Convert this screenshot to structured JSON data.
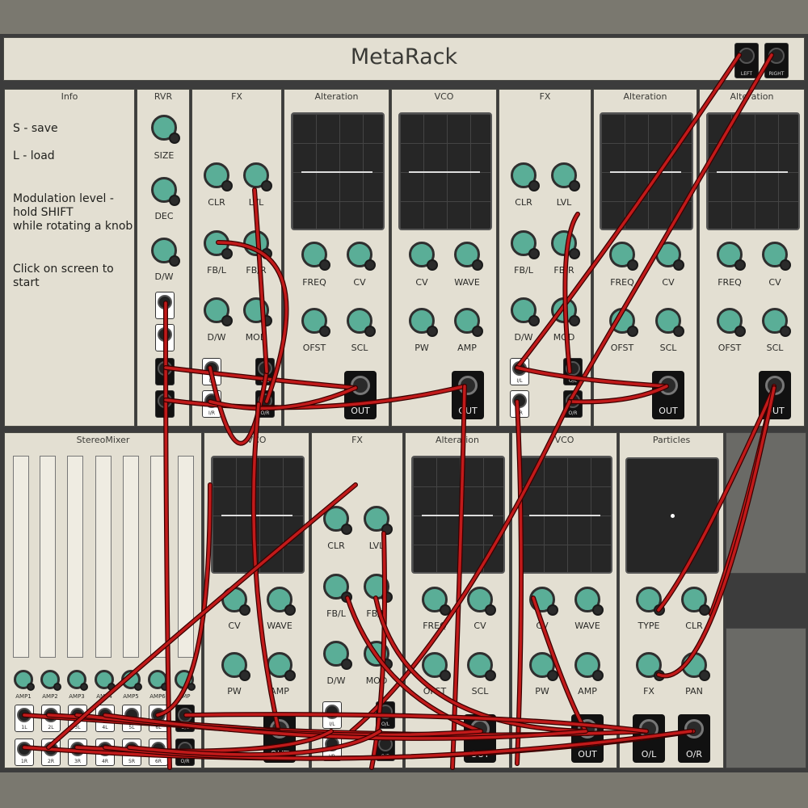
{
  "header": {
    "title": "MetaRack",
    "left_label": "LEFT",
    "right_label": "RIGHT"
  },
  "info": {
    "title": "Info",
    "line1": "S - save",
    "line2": "L - load",
    "line3": "Modulation level -",
    "line4": "hold SHIFT",
    "line5": "while rotating a knob",
    "line6": "Click on screen to start"
  },
  "rvr": {
    "title": "RVR",
    "size": "SIZE",
    "dec": "DEC",
    "dw": "D/W"
  },
  "fx": {
    "title": "FX",
    "clr": "CLR",
    "lvl": "LVL",
    "fbl": "FB/L",
    "fbr": "FB/R",
    "dw": "D/W",
    "mod": "MOD",
    "il": "I/L",
    "ir": "I/R",
    "ol": "O/L",
    "or": "O/R"
  },
  "alteration": {
    "title": "Alteration",
    "freq": "FREQ",
    "cv": "CV",
    "ofst": "OFST",
    "scl": "SCL",
    "out": "OUT"
  },
  "vco": {
    "title": "VCO",
    "cv": "CV",
    "wave": "WAVE",
    "pw": "PW",
    "amp": "AMP",
    "out": "OUT"
  },
  "mixer": {
    "title": "StereoMixer",
    "amps": [
      "AMP1",
      "AMP2",
      "AMP3",
      "AMP4",
      "AMP5",
      "AMP6",
      "AMP"
    ],
    "inputs_l": [
      "1L",
      "2L",
      "3L",
      "4L",
      "5L",
      "6L"
    ],
    "inputs_r": [
      "1R",
      "2R",
      "3R",
      "4R",
      "5R",
      "6R"
    ],
    "ol": "O/L",
    "or": "O/R"
  },
  "particles": {
    "title": "Particles",
    "type": "TYPE",
    "clr": "CLR",
    "fx": "FX",
    "pan": "PAN",
    "ol": "O/L",
    "or": "O/R"
  },
  "colors": {
    "cable": "#c11a1a",
    "cable_dark": "#3a0000",
    "knob": "#5aae97",
    "panel": "#e3dfd2"
  }
}
